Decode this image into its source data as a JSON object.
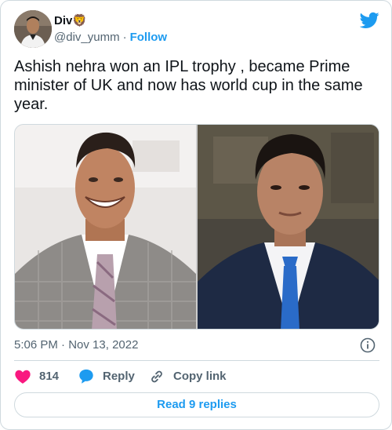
{
  "author": {
    "display_name": "Div",
    "emoji": "🦁",
    "handle": "@div_yumm",
    "separator": "·",
    "follow_label": "Follow"
  },
  "tweet": {
    "text": "Ashish nehra won an IPL trophy , became Prime minister of UK and now has world cup in the same year.",
    "time": "5:06 PM",
    "separator": "·",
    "date": "Nov 13, 2022"
  },
  "actions": {
    "like_count": "814",
    "reply_label": "Reply",
    "copy_label": "Copy link"
  },
  "footer": {
    "read_replies_label": "Read 9 replies"
  },
  "colors": {
    "accent": "#1d9bf0",
    "like": "#f91880",
    "muted": "#536471",
    "border": "#cfd9de"
  },
  "icons": [
    "twitter-bird-icon",
    "info-icon",
    "heart-icon",
    "reply-bubble-icon",
    "link-icon"
  ]
}
